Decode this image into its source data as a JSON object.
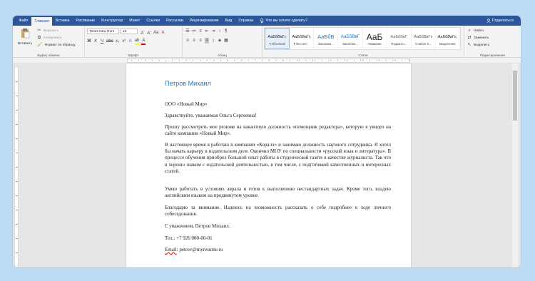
{
  "tabs": [
    "Файл",
    "Главная",
    "Вставка",
    "Рисование",
    "Конструктор",
    "Макет",
    "Ссылки",
    "Рассылки",
    "Рецензирование",
    "Вид",
    "Справка"
  ],
  "tell_me": "Что вы хотите сделать?",
  "share": "Поделиться",
  "clipboard": {
    "paste": "Вставить",
    "cut": "Вырезать",
    "copy": "Копировать",
    "format": "Формат по образцу",
    "label": "Буфер обмена"
  },
  "font": {
    "name": "Times New Rom",
    "size": "12",
    "label": "Шрифт"
  },
  "paragraph": {
    "label": "Абзац"
  },
  "styles": {
    "label": "Стили",
    "items": [
      {
        "preview": "АаБбВвГг,",
        "name": "¶ Обычный"
      },
      {
        "preview": "АаБбВвГг,",
        "name": "¶ Без инт..."
      },
      {
        "preview": "АаБбВ",
        "name": "Заголово..."
      },
      {
        "preview": "АаБбВвГ",
        "name": "Заголово..."
      },
      {
        "preview": "АаБ",
        "name": "Название"
      },
      {
        "preview": "АаБбВвГ",
        "name": "Подзагол..."
      },
      {
        "preview": "АаБбВвГг",
        "name": "Слабое в..."
      },
      {
        "preview": "АаБбВвГг,",
        "name": "Выделение"
      }
    ]
  },
  "editing": {
    "find": "Найти",
    "replace": "Заменить",
    "select": "Выделить",
    "label": "Редактирование"
  },
  "ruler_text": "· 3 · 1 · 2 · 1 · 1 · | · 1 · 1 · 2 · 1 · 3 · 1 · 4 · 1 · 5 · 1 · 6 · 1 · 7 · 1 · 8 · 1 · 9 · 1 · 10 · 1 · 11 · 1 · 12 · 1 · 13 · 1 · 14 · 1 · 15 · 1 · 16 · 1 · 17",
  "document": {
    "name": "Петров Михаил",
    "company": "ООО «Новый Мир»",
    "greeting": "Здравствуйте, уважаемая Ольга Сергеевна!",
    "p1": "Прошу рассмотреть мое резюме на вакантную должность «помощник редактора», которую я увидел на сайте компании «Новый Мир».",
    "p2": "В настоящее время я работаю в компании «Коралл» и занимаю должность научного сотрудника. Я хотел бы начать карьеру в издательском деле. Окончил МОУ по специальности «русский язык и литература». В процессе обучения приобрел большой опыт работы в студенческой газете в качестве журналиста. Так что я хорошо знаком с издательской деятельностью, в том числе, с подготовкой качественных и интересных статей.",
    "p3": "Умею работать в условиях аврала и готов к выполнению нестандартных задач. Кроме того, владею английским языком на продвинутом уровне.",
    "p4": "Благодарю за внимание. Надеюсь на возможность рассказать о себе подробнее в ходе личного собеседования.",
    "closing": "С уважением, Петров Михаил.",
    "phone": "Тел.: +7 926 000-00-01",
    "email_label": "Email",
    "email_value": ": petrov@myresume.ru"
  }
}
